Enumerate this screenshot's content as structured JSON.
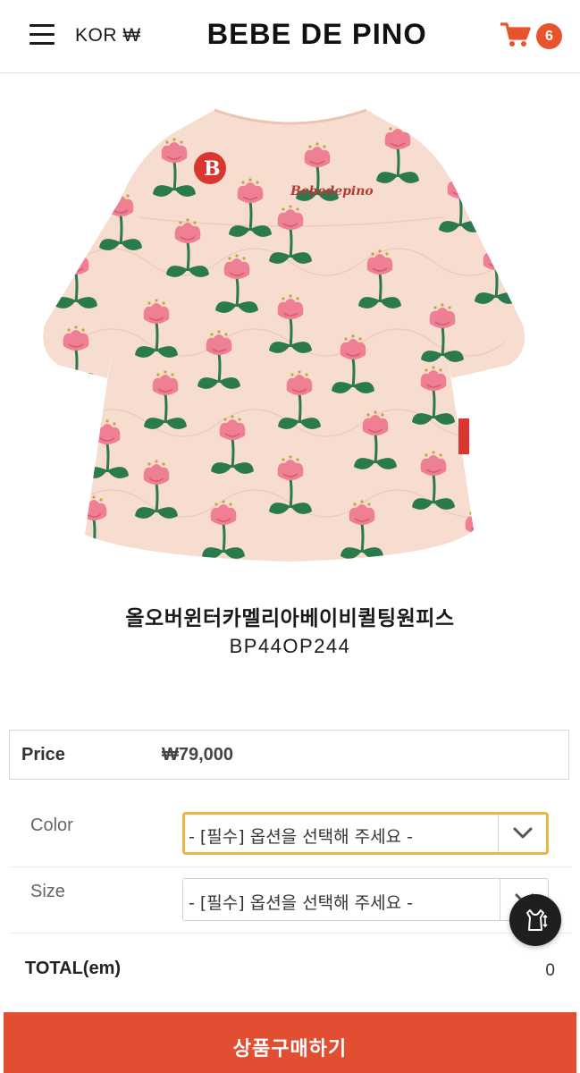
{
  "header": {
    "currency_label": "KOR ₩",
    "brand": "BEBE DE PINO",
    "cart_count": "6"
  },
  "product": {
    "name": "올오버윈터카멜리아베이비퀼팅원피스",
    "code": "BP44OP244",
    "image_logo_text": "Bebedepino",
    "image_badge_text": "B"
  },
  "price": {
    "label": "Price",
    "value": "₩79,000"
  },
  "options": [
    {
      "label": "Color",
      "placeholder": "- [필수] 옵션을 선택해 주세요 -"
    },
    {
      "label": "Size",
      "placeholder": "- [필수] 옵션을 선택해 주세요 -"
    }
  ],
  "total": {
    "label": "TOTAL(em)",
    "value": "0"
  },
  "buy_button": {
    "label": "상품구매하기"
  },
  "colors": {
    "accent": "#e24e32",
    "badge": "#e6542e",
    "focus_border": "#e9b544",
    "dress_base": "#f7ddcf",
    "flower_pink": "#ef7f92",
    "leaf_green": "#2a7a4e"
  },
  "icons": [
    "menu-icon",
    "cart-icon",
    "chevron-down-icon",
    "fit-icon"
  ]
}
